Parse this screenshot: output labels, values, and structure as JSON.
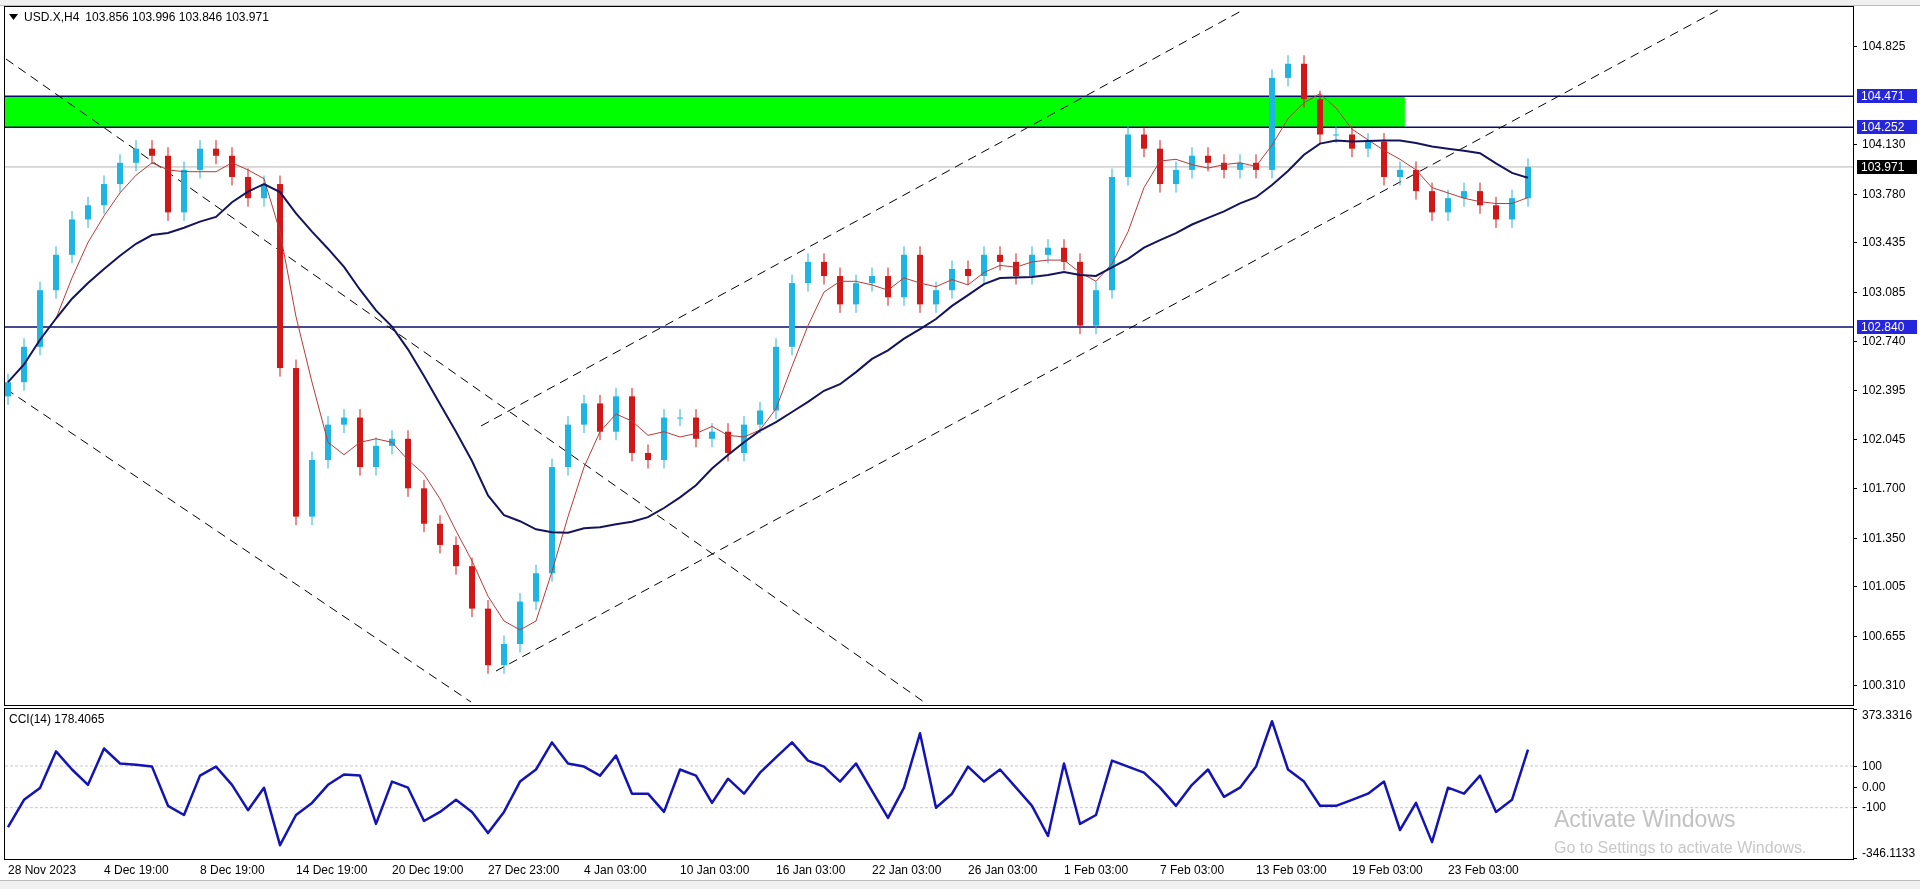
{
  "chart_header": {
    "symbol": "USD.X,H4",
    "ohlc": "103.856 103.996 103.846 103.971"
  },
  "price_chart": {
    "axis_labels": [
      "104.825",
      "104.130",
      "103.780",
      "103.435",
      "103.085",
      "102.740",
      "102.395",
      "102.045",
      "101.700",
      "101.350",
      "101.005",
      "100.655",
      "100.310"
    ],
    "levels": [
      {
        "kind": "level",
        "label": "104.471"
      },
      {
        "kind": "level",
        "label": "104.252"
      },
      {
        "kind": "price",
        "label": "103.971"
      },
      {
        "kind": "level",
        "label": "102.840"
      }
    ]
  },
  "cci_panel": {
    "chart_data": {
      "type": "line",
      "title": "CCI(14) 178.4065",
      "ylim": [
        -346.1133,
        373.3316
      ],
      "series": [
        {
          "color": "#1414b4",
          "values": [
            -193,
            -62,
            -5,
            170,
            83,
            10,
            184,
            112,
            106,
            97,
            -91,
            -135,
            54,
            97,
            10,
            -112,
            -4,
            -280,
            -135,
            -77,
            10,
            59,
            54,
            -178,
            25,
            -4,
            -164,
            -120,
            -62,
            -120,
            -222,
            -120,
            25,
            83,
            213,
            112,
            97,
            54,
            150,
            -33,
            -33,
            -120,
            83,
            54,
            -77,
            39,
            -33,
            68,
            141,
            213,
            126,
            97,
            25,
            112,
            -19,
            -149,
            -4,
            257,
            -100,
            -33,
            97,
            25,
            83,
            -4,
            -91,
            -236,
            112,
            -178,
            -135,
            126,
            97,
            68,
            -4,
            -91,
            10,
            83,
            -48,
            -4,
            97,
            315,
            83,
            25,
            -91,
            -91,
            -62,
            -33,
            25,
            -207,
            -77,
            -265,
            -4,
            -33,
            54,
            -120,
            -62,
            178
          ]
        }
      ],
      "yticks": [
        {
          "value": 373.3316,
          "label": "373.3316"
        },
        {
          "value": 100,
          "label": "100"
        },
        {
          "value": 0,
          "label": "0.00"
        },
        {
          "value": -100,
          "label": "-100"
        },
        {
          "value": -346.1133,
          "label": "-346.1133"
        }
      ]
    }
  },
  "time_axis": {
    "labels": [
      "28 Nov 2023",
      "4 Dec 19:00",
      "8 Dec 19:00",
      "14 Dec 19:00",
      "20 Dec 19:00",
      "27 Dec 23:00",
      "4 Jan 03:00",
      "10 Jan 03:00",
      "16 Jan 03:00",
      "22 Jan 03:00",
      "26 Jan 03:00",
      "1 Feb 03:00",
      "7 Feb 03:00",
      "13 Feb 03:00",
      "19 Feb 03:00",
      "23 Feb 03:00"
    ]
  },
  "os_notice": {
    "title": "Activate Windows",
    "message": "Go to Settings to activate Windows."
  }
}
